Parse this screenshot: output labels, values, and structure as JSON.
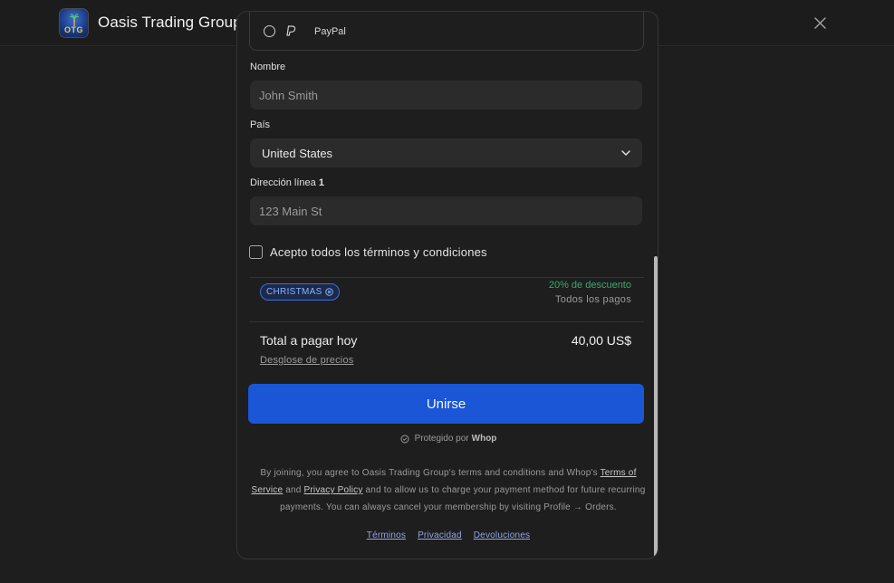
{
  "header": {
    "brand_name": "Oasis Trading Group",
    "logo_text": "OTG"
  },
  "payment": {
    "paypal_label": "PayPal"
  },
  "form": {
    "name_label": "Nombre",
    "name_placeholder": "John Smith",
    "country_label": "País",
    "country_value": "United States",
    "address_label": "Dirección línea",
    "address_label_num": "1",
    "address_placeholder": "123 Main St",
    "terms_label": "Acepto todos los términos y condiciones"
  },
  "coupon": {
    "code": "CHRISTMAS",
    "discount": "20% de descuento",
    "scope": "Todos los pagos"
  },
  "summary": {
    "total_label": "Total a pagar hoy",
    "total_value": "40,00 US$",
    "breakdown_link": "Desglose de precios"
  },
  "actions": {
    "join_label": "Unirse"
  },
  "protected": {
    "text": "Protegido por",
    "brand": "Whop"
  },
  "legal": {
    "part1": "By joining, you agree to Oasis Trading Group's terms and conditions and Whop's ",
    "tos": "Terms of Service",
    "part2": " and ",
    "privacy": "Privacy Policy",
    "part3": " and to allow us to charge your payment method for future recurring payments. You can always cancel your membership by visiting Profile → Orders."
  },
  "footer": {
    "terms": "Términos",
    "privacy": "Privacidad",
    "refunds": "Devoluciones"
  },
  "colors": {
    "accent": "#1a56d6",
    "discount": "#3ba86a",
    "coupon_border": "#3f6fd8"
  }
}
